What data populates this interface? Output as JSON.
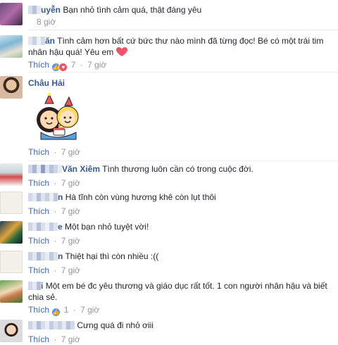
{
  "like_label": "Thích",
  "dot": "·",
  "comments": [
    {
      "id": "c1",
      "name_suffix": "uyễn",
      "text": "Bạn nhỏ tình cảm quá, thật đáng yêu",
      "time": "8 giờ",
      "show_like": false
    },
    {
      "id": "c2",
      "name_suffix": "ăn",
      "text": "Tình cảm hơn bất cứ bức thư nào mình đã từng đọc! Bé có một trái tim nhân hậu quá! Yêu em",
      "time": "7 giờ",
      "react_count": "7",
      "show_like": true,
      "heart": true
    },
    {
      "id": "c3",
      "name": "Châu Hải",
      "time": "7 giờ",
      "sticker": true
    },
    {
      "id": "c4",
      "name_suffix": "Văn Xiêm",
      "text": "Tình thương luôn cần có trong cuộc đời.",
      "time": "7 giờ"
    },
    {
      "id": "c5",
      "name_suffix": "n",
      "text": "Hà tĩnh còn vùng hương khê còn lụt thôi",
      "time": "7 giờ"
    },
    {
      "id": "c6",
      "name_suffix": "e",
      "text": "Một bạn nhỏ tuyệt vời!",
      "time": "7 giờ"
    },
    {
      "id": "c7",
      "name_suffix": "n",
      "text": "Thiệt hại thì còn nhiều :((",
      "time": "7 giờ"
    },
    {
      "id": "c8",
      "name_suffix": "i",
      "text": "Một em bé đc yêu thương và giáo dục rất tốt. 1 con người nhân hậu và biết chia sẻ.",
      "time": "7 giờ",
      "react_count": "1"
    },
    {
      "id": "c9",
      "name_suffix": "",
      "text": "Cưng quá đi nhỏ ơiii",
      "time": "7 giờ"
    }
  ],
  "colors": {
    "name": "#365899",
    "meta": "#90949c",
    "like": "#4267b2",
    "text": "#1d2129"
  }
}
